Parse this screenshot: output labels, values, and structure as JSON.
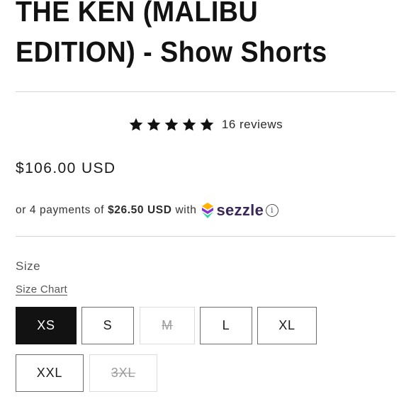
{
  "product": {
    "title": "THE KEN (MALIBU EDITION) - Show Shorts",
    "price": "$106.00 USD"
  },
  "rating": {
    "stars": 5,
    "stars_max": 5,
    "reviews_text": "16 reviews"
  },
  "installments": {
    "prefix": "or 4 payments of",
    "amount": "$26.50 USD",
    "connector": "with",
    "provider": "sezzle",
    "info_icon": "info-icon",
    "logo_colors": [
      "#ffb200",
      "#8333d4",
      "#29d3a2"
    ]
  },
  "size": {
    "label": "Size",
    "chart_link": "Size Chart",
    "options": [
      {
        "label": "XS",
        "state": "selected"
      },
      {
        "label": "S",
        "state": "available"
      },
      {
        "label": "M",
        "state": "sold-out"
      },
      {
        "label": "L",
        "state": "available"
      },
      {
        "label": "XL",
        "state": "available"
      },
      {
        "label": "XXL",
        "state": "available"
      },
      {
        "label": "3XL",
        "state": "sold-out"
      }
    ]
  },
  "colors": {
    "text": "#121212",
    "selected_bg": "#121212",
    "divider": "#d6d6d6",
    "sezzle_purple": "#382757"
  }
}
